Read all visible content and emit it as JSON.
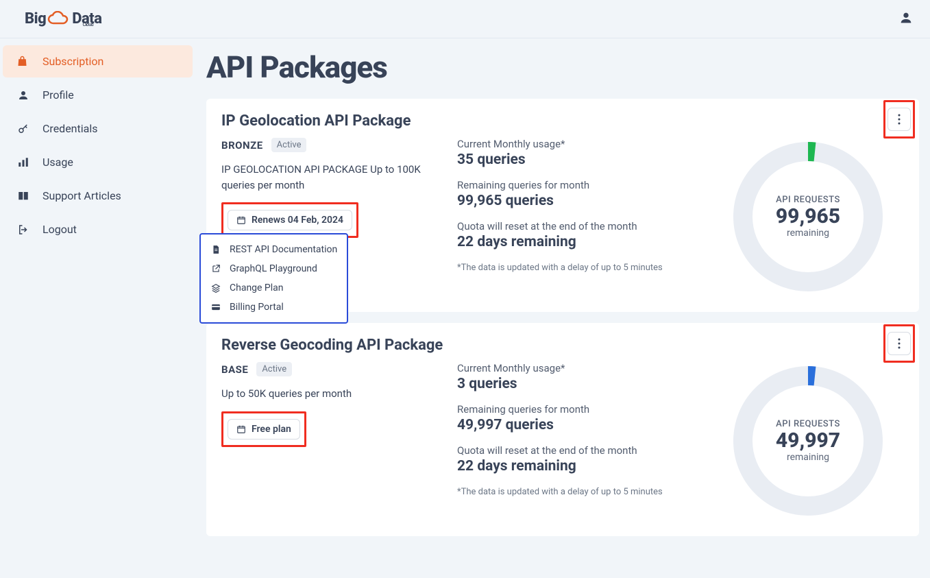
{
  "sidebar": {
    "items": [
      {
        "label": "Subscription"
      },
      {
        "label": "Profile"
      },
      {
        "label": "Credentials"
      },
      {
        "label": "Usage"
      },
      {
        "label": "Support Articles"
      },
      {
        "label": "Logout"
      }
    ]
  },
  "page": {
    "title": "API Packages"
  },
  "packages": [
    {
      "title": "IP Geolocation API Package",
      "tier": "BRONZE",
      "status": "Active",
      "desc": "IP GEOLOCATION API PACKAGE Up to 100K queries per month",
      "chip": "Renews 04 Feb, 2024",
      "usage_label": "Current Monthly usage*",
      "usage_value": "35 queries",
      "remaining_label": "Remaining queries for month",
      "remaining_value": "99,965 queries",
      "reset_label": "Quota will reset at the end of the month",
      "reset_value": "22 days remaining",
      "note": "*The data is updated with a delay of up to 5 minutes",
      "donut": {
        "label": "API REQUESTS",
        "value": "99,965",
        "sub": "remaining",
        "color": "#1eb751"
      }
    },
    {
      "title": "Reverse Geocoding API Package",
      "tier": "BASE",
      "status": "Active",
      "desc": "Up to 50K queries per month",
      "chip": "Free plan",
      "usage_label": "Current Monthly usage*",
      "usage_value": "3 queries",
      "remaining_label": "Remaining queries for month",
      "remaining_value": "49,997 queries",
      "reset_label": "Quota will reset at the end of the month",
      "reset_value": "22 days remaining",
      "note": "*The data is updated with a delay of up to 5 minutes",
      "donut": {
        "label": "API REQUESTS",
        "value": "49,997",
        "sub": "remaining",
        "color": "#2a6fdb"
      }
    }
  ],
  "menu": {
    "items": [
      {
        "label": "REST API Documentation"
      },
      {
        "label": "GraphQL Playground"
      },
      {
        "label": "Change Plan"
      },
      {
        "label": "Billing Portal"
      }
    ]
  },
  "chart_data": [
    {
      "type": "pie",
      "title": "API REQUESTS",
      "series": [
        {
          "name": "used",
          "values": [
            35
          ]
        },
        {
          "name": "remaining",
          "values": [
            99965
          ]
        }
      ],
      "total": 100000
    },
    {
      "type": "pie",
      "title": "API REQUESTS",
      "series": [
        {
          "name": "used",
          "values": [
            3
          ]
        },
        {
          "name": "remaining",
          "values": [
            49997
          ]
        }
      ],
      "total": 50000
    }
  ]
}
